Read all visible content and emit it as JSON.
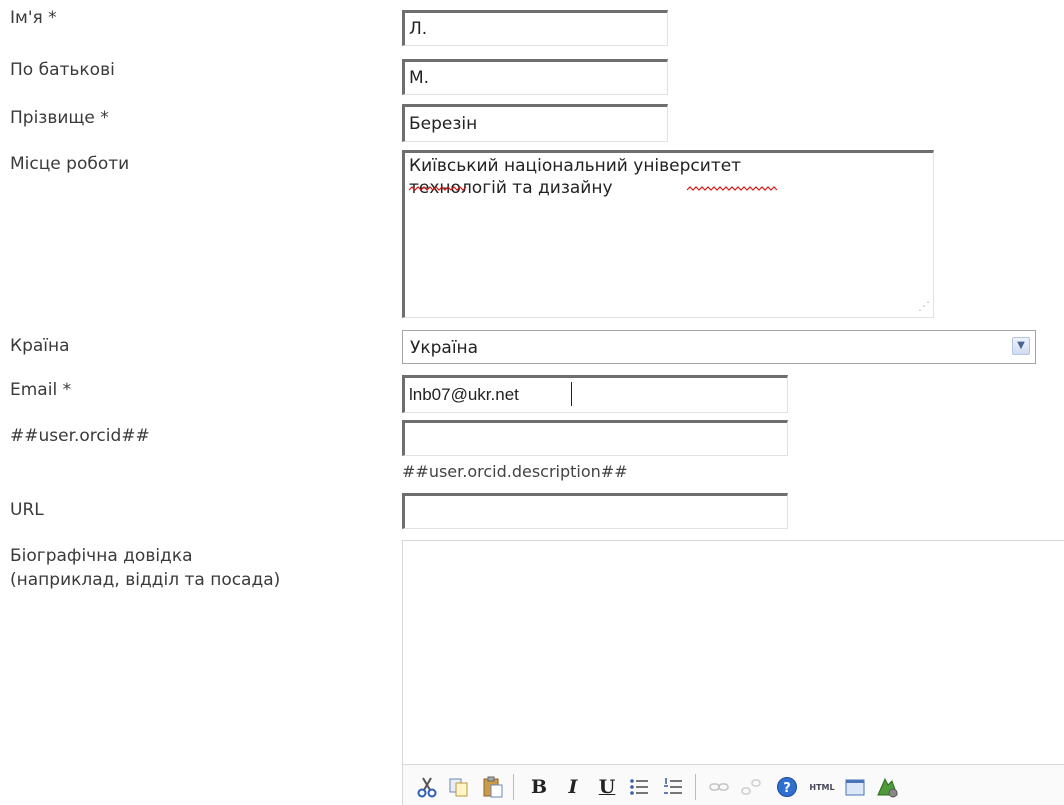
{
  "form": {
    "first_name": {
      "label": "Ім'я *",
      "value": "Л."
    },
    "middle_name": {
      "label": "По батькові",
      "value": "М."
    },
    "last_name": {
      "label": "Прізвище *",
      "value": "Березін"
    },
    "affiliation": {
      "label": "Місце роботи",
      "value": "Київський національний університет\nтехнологій та дизайну"
    },
    "country": {
      "label": "Країна",
      "value": "Україна"
    },
    "email": {
      "label": "Email *",
      "value": "lnb07@ukr.net"
    },
    "orcid": {
      "label": "##user.orcid##",
      "value": "",
      "description": "##user.orcid.description##"
    },
    "url": {
      "label": "URL",
      "value": ""
    },
    "bio": {
      "label_line1": "Біографічна довідка",
      "label_line2": "(наприклад, відділ та посада)",
      "value": ""
    }
  },
  "toolbar": {
    "items": [
      "cut-icon",
      "copy-icon",
      "paste-icon",
      "bold-icon",
      "italic-icon",
      "underline-icon",
      "bullet-list-icon",
      "numbered-list-icon",
      "link-icon",
      "unlink-icon",
      "help-icon",
      "html-source-icon",
      "fullscreen-icon",
      "image-icon"
    ],
    "bold_glyph": "B",
    "italic_glyph": "I",
    "underline_glyph": "U",
    "html_text": "HTML"
  },
  "colors": {
    "label": "#3a3a3a",
    "field_border_dark": "#6e6e6e",
    "select_arrow": "#4a6591",
    "spell_underline": "#d11a1a"
  }
}
